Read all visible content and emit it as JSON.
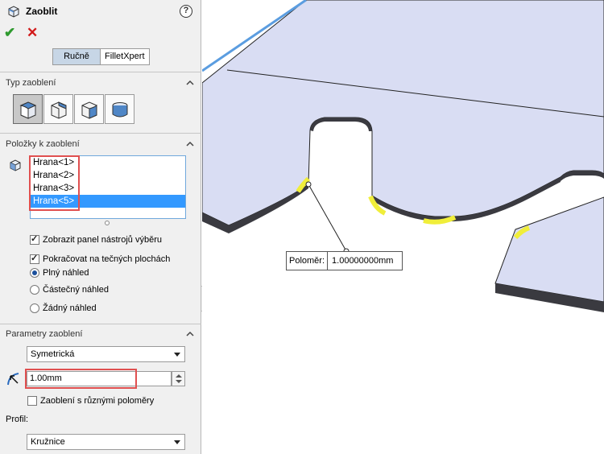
{
  "panel": {
    "title": "Zaoblit",
    "help_icon": "question-circle-icon",
    "ok_icon": "check-icon",
    "cancel_icon": "x-icon",
    "mode_tabs": [
      {
        "label": "Ručně",
        "active": true
      },
      {
        "label": "FilletXpert",
        "active": false
      }
    ]
  },
  "fillet_type": {
    "title": "Typ zaoblení",
    "buttons": [
      {
        "icon": "constant-size-fillet-icon",
        "active": true
      },
      {
        "icon": "variable-size-fillet-icon",
        "active": false
      },
      {
        "icon": "face-fillet-icon",
        "active": false
      },
      {
        "icon": "full-round-fillet-icon",
        "active": false
      }
    ]
  },
  "items": {
    "title": "Položky k zaoblení",
    "list": [
      "Hrana<1>",
      "Hrana<2>",
      "Hrana<3>",
      "Hrana<5>"
    ],
    "selected_index": 3,
    "show_toolbar": {
      "label": "Zobrazit panel nástrojů výběru",
      "checked": true
    },
    "tangent": {
      "label": "Pokračovat na tečných plochách",
      "checked": true
    },
    "preview_options": [
      {
        "label": "Plný náhled",
        "selected": true
      },
      {
        "label": "Částečný náhled",
        "selected": false
      },
      {
        "label": "Žádný náhled",
        "selected": false
      }
    ]
  },
  "params": {
    "title": "Parametry zaoblení",
    "method": "Symetrická",
    "radius": "1.00mm",
    "multi_radius": {
      "label": "Zaoblení s různými poloměry",
      "checked": false
    },
    "profile_label": "Profil:",
    "profile": "Kružnice"
  },
  "viewport": {
    "callout_label": "Poloměr:",
    "callout_value": "1.00000000mm"
  },
  "colors": {
    "accent": "#3399ff",
    "highlight_box": "#e05050",
    "face": "#d9ddf3",
    "edge_highlight": "#f0ee3a"
  }
}
